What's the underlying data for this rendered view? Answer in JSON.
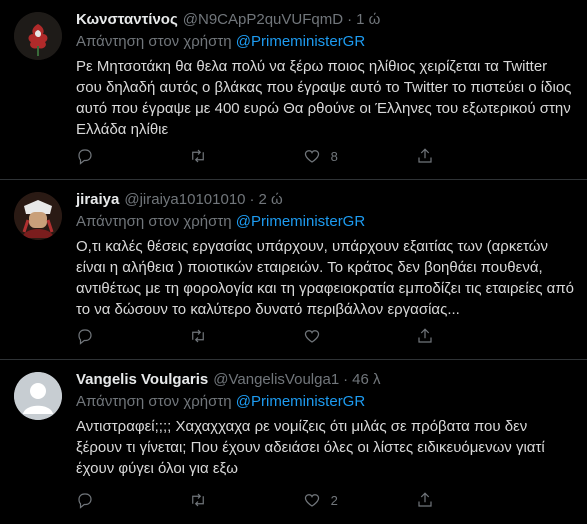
{
  "tweets": [
    {
      "name": "Κωνσταντίνος",
      "handle": "@N9CApP2quVUFqmD",
      "time": "1 ώ",
      "reply_prefix": "Απάντηση στον χρήστη",
      "reply_to": "@PrimeministerGR",
      "text": "Ρε Μητσοτάκη θα θελα πολύ να ξέρω ποιος ηλίθιος χειρίζεται τα Twitter σου δηλαδή αυτός ο βλάκας που έγραψε αυτό το Twitter το πιστεύει ο ίδιος αυτό που έγραψε με 400 ευρώ Θα ρθούνε οι Έλληνες του εξωτερικού στην Ελλάδα ηλίθιε",
      "counts": {
        "reply": "",
        "retweet": "",
        "like": "8"
      },
      "avatar_icon": "rose-avatar-icon"
    },
    {
      "name": "jiraiya",
      "handle": "@jiraiya10101010",
      "time": "2 ώ",
      "reply_prefix": "Απάντηση στον χρήστη",
      "reply_to": "@PrimeministerGR",
      "text": "Ο,τι καλές θέσεις εργασίας υπάρχουν, υπάρχουν εξαιτίας των (αρκετών είναι η αλήθεια ) ποιοτικών εταιρειών. Το κράτος δεν βοηθάει πουθενά, αντιθέτως με τη φορολογία και τη γραφειοκρατία εμποδίζει τις εταιρείες από το να δώσουν το καλύτερο δυνατό περιβάλλον εργασίας...",
      "counts": {
        "reply": "",
        "retweet": "",
        "like": ""
      },
      "avatar_icon": "character-avatar-icon"
    },
    {
      "name": "Vangelis Voulgaris",
      "handle": "@VangelisVoulga1",
      "time": "46 λ",
      "reply_prefix": "Απάντηση στον χρήστη",
      "reply_to": "@PrimeministerGR",
      "text": "Αντιστραφεί;;;; Χαχαχχαχα ρε νομίζεις ότι μιλάς σε πρόβατα που δεν ξέρουν τι γίνεται; Που έχουν αδειάσει όλες οι λίστες ειδικευόμενων γιατί έχουν φύγει όλοι για εξω",
      "counts": {
        "reply": "",
        "retweet": "",
        "like": "2"
      },
      "avatar_icon": "default-user-avatar-icon"
    }
  ],
  "icons": {
    "reply": "reply-icon",
    "retweet": "retweet-icon",
    "like": "heart-icon",
    "share": "share-icon"
  },
  "colors": {
    "background": "#000000",
    "mention": "#1d9bf0",
    "muted": "#71767b",
    "border": "#2f3336"
  }
}
